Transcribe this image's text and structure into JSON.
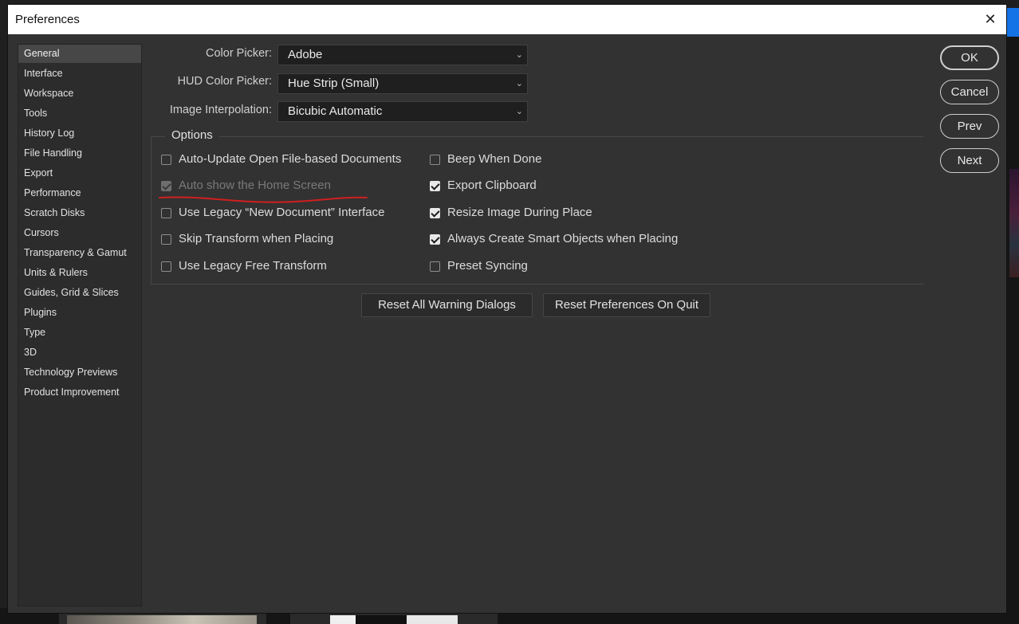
{
  "window": {
    "title": "Preferences",
    "close_glyph": "✕"
  },
  "sidebar": {
    "items": [
      {
        "label": "General",
        "active": true
      },
      {
        "label": "Interface"
      },
      {
        "label": "Workspace"
      },
      {
        "label": "Tools"
      },
      {
        "label": "History Log"
      },
      {
        "label": "File Handling"
      },
      {
        "label": "Export"
      },
      {
        "label": "Performance"
      },
      {
        "label": "Scratch Disks"
      },
      {
        "label": "Cursors"
      },
      {
        "label": "Transparency & Gamut"
      },
      {
        "label": "Units & Rulers"
      },
      {
        "label": "Guides, Grid & Slices"
      },
      {
        "label": "Plugins"
      },
      {
        "label": "Type"
      },
      {
        "label": "3D"
      },
      {
        "label": "Technology Previews"
      },
      {
        "label": "Product Improvement"
      }
    ]
  },
  "settings": {
    "color_picker": {
      "label": "Color Picker:",
      "value": "Adobe"
    },
    "hud_color_picker": {
      "label": "HUD Color Picker:",
      "value": "Hue Strip (Small)"
    },
    "image_interpolation": {
      "label": "Image Interpolation:",
      "value": "Bicubic Automatic"
    }
  },
  "options": {
    "title": "Options",
    "left": [
      {
        "label": "Auto-Update Open File-based Documents",
        "checked": false,
        "disabled": false
      },
      {
        "label": "Auto show the Home Screen",
        "checked": true,
        "disabled": true
      },
      {
        "label": "Use Legacy “New Document” Interface",
        "checked": false,
        "disabled": false
      },
      {
        "label": "Skip Transform when Placing",
        "checked": false,
        "disabled": false
      },
      {
        "label": "Use Legacy Free Transform",
        "checked": false,
        "disabled": false
      }
    ],
    "right": [
      {
        "label": "Beep When Done",
        "checked": false
      },
      {
        "label": "Export Clipboard",
        "checked": true
      },
      {
        "label": "Resize Image During Place",
        "checked": true
      },
      {
        "label": "Always Create Smart Objects when Placing",
        "checked": true
      },
      {
        "label": "Preset Syncing",
        "checked": false
      }
    ]
  },
  "actions": {
    "reset_warnings": "Reset All Warning Dialogs",
    "reset_prefs": "Reset Preferences On Quit"
  },
  "buttons": {
    "ok": "OK",
    "cancel": "Cancel",
    "prev": "Prev",
    "next": "Next"
  },
  "annotation": {
    "underline_color": "#d01f1f"
  },
  "colors": {
    "dialog_bg": "#323232",
    "select_bg": "#1f1f1f",
    "sidebar_active": "#474747"
  }
}
